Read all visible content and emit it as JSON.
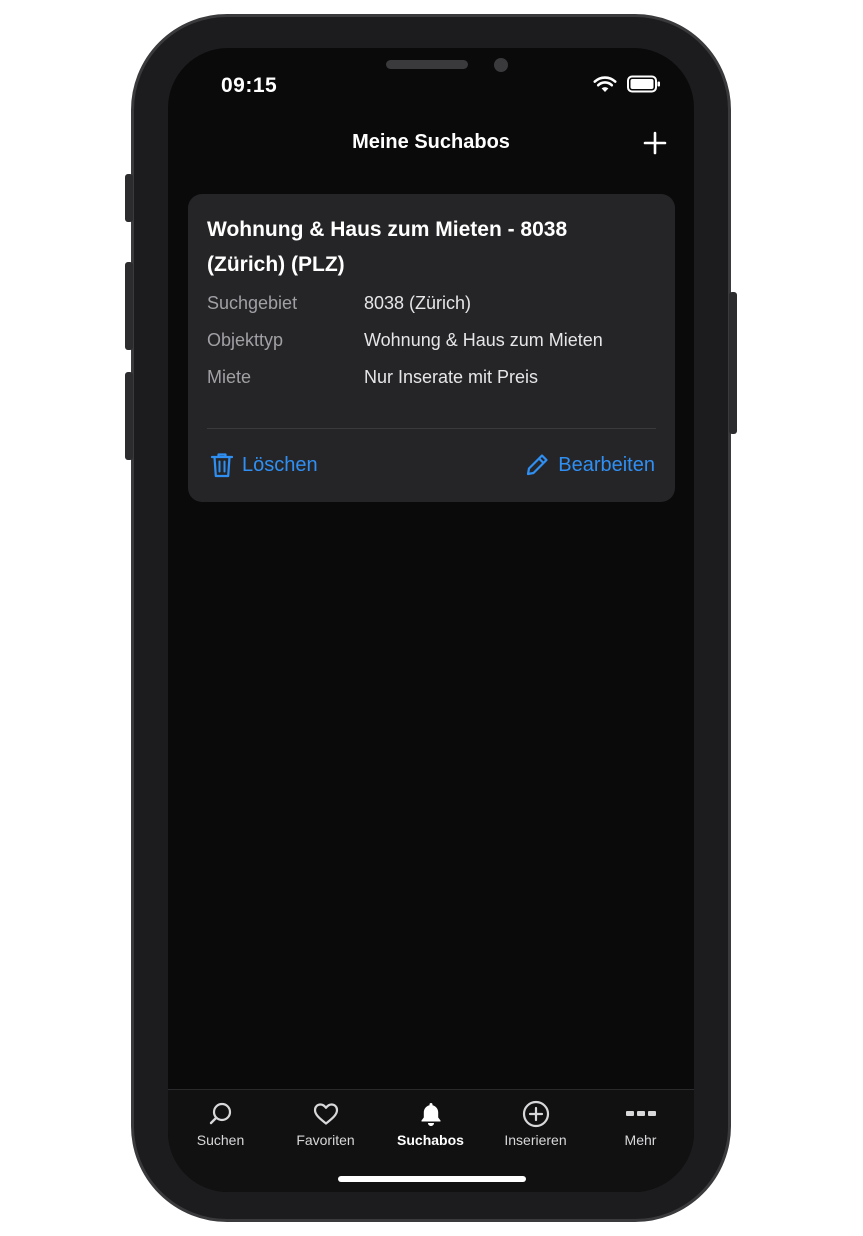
{
  "status_bar": {
    "time": "09:15",
    "wifi_icon": "wifi-icon",
    "battery_icon": "battery-icon"
  },
  "nav": {
    "title": "Meine Suchabos",
    "add_icon": "plus-icon"
  },
  "subscription_card": {
    "title": "Wohnung & Haus zum Mieten - 8038 (Zürich) (PLZ)",
    "rows": [
      {
        "label": "Suchgebiet",
        "value": "8038 (Zürich)"
      },
      {
        "label": "Objekttyp",
        "value": "Wohnung & Haus zum Mieten"
      },
      {
        "label": "Miete",
        "value": "Nur Inserate mit Preis"
      }
    ],
    "delete_label": "Löschen",
    "delete_icon": "trash-icon",
    "edit_label": "Bearbeiten",
    "edit_icon": "pencil-icon"
  },
  "tabbar": {
    "active": "Suchabos",
    "tabs": [
      {
        "label": "Suchen",
        "icon": "search-icon"
      },
      {
        "label": "Favoriten",
        "icon": "heart-icon"
      },
      {
        "label": "Suchabos",
        "icon": "bell-icon"
      },
      {
        "label": "Inserieren",
        "icon": "plus-circle-icon"
      },
      {
        "label": "Mehr",
        "icon": "more-icon"
      }
    ]
  },
  "colors": {
    "accent": "#2f8ff3",
    "background": "#0a0a0b",
    "card": "#252527"
  }
}
